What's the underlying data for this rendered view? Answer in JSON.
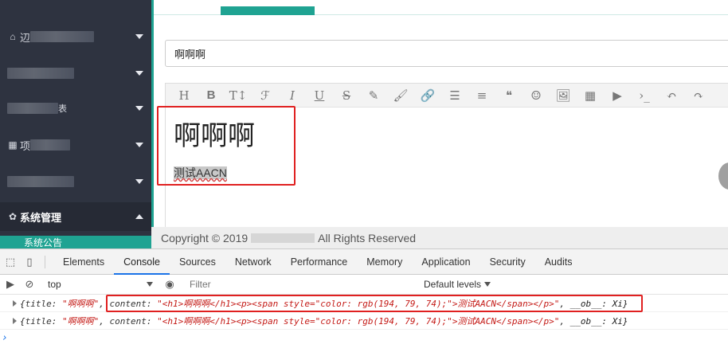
{
  "sidebar": {
    "items": [
      {
        "prefix": "辺"
      },
      {
        "prefix": ""
      },
      {
        "prefix": "",
        "suffix": "表"
      },
      {
        "prefix": "项"
      },
      {
        "prefix": ""
      },
      {
        "label": "系统管理"
      }
    ],
    "sub_item": "系统公告"
  },
  "main": {
    "title_value": "啊啊啊",
    "toolbar": [
      "H",
      "B",
      "T↕",
      "ℱ",
      "I",
      "U",
      "S",
      "✎",
      "🖌",
      "🔗",
      "☰",
      "≡",
      "❝",
      "☺",
      "🖼",
      "▦",
      "▶",
      "›_",
      "↶",
      "↷"
    ],
    "content": {
      "heading": "啊啊啊",
      "paragraph": "测试AACN"
    },
    "footer": {
      "prefix": "Copyright © 2019",
      "suffix": "All Rights Reserved"
    }
  },
  "devtools": {
    "tabs": [
      "Elements",
      "Console",
      "Sources",
      "Network",
      "Performance",
      "Memory",
      "Application",
      "Security",
      "Audits"
    ],
    "active_tab": "Console",
    "context": "top",
    "filter_placeholder": "Filter",
    "levels": "Default levels",
    "log": {
      "open": "{",
      "title_key": "title: ",
      "title_val": "\"啊啊啊\"",
      "comma1": ", ",
      "content_key": "content: ",
      "content_val": "\"<h1>啊啊啊</h1><p><span style=\"color: rgb(194, 79, 74);\">测试AACN</span></p>\"",
      "rest": ", __ob__: Xi}"
    }
  },
  "colors": {
    "accent": "#1fa392",
    "sidebar_bg": "#2e3340",
    "highlight": "#e02020"
  }
}
